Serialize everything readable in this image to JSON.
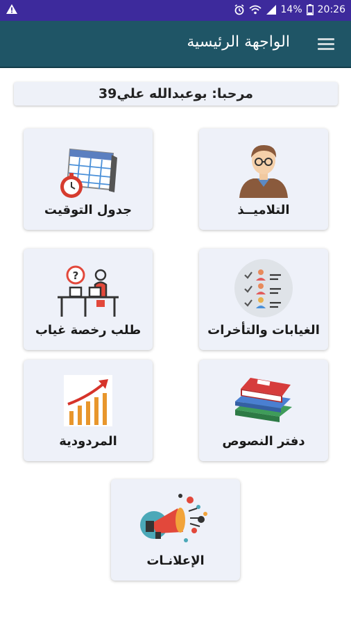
{
  "status_bar": {
    "battery": "14%",
    "time": "20:26"
  },
  "app_bar": {
    "title": "الواجهة الرئيسية"
  },
  "welcome": {
    "text": "مرحبا: بوعبدالله علي39"
  },
  "menu_cards": [
    {
      "label": "التلاميــذ",
      "icon": "student-icon"
    },
    {
      "label": "جدول التوقيت",
      "icon": "timetable-icon"
    },
    {
      "label": "الغيابات والتأخرات",
      "icon": "attendance-checklist-icon"
    },
    {
      "label": "طلب رخصة غياب",
      "icon": "absence-request-icon"
    },
    {
      "label": "دفتر النصوص",
      "icon": "books-icon"
    },
    {
      "label": "المردودية",
      "icon": "growth-chart-icon"
    },
    {
      "label": "الإعلانـات",
      "icon": "megaphone-icon"
    }
  ]
}
